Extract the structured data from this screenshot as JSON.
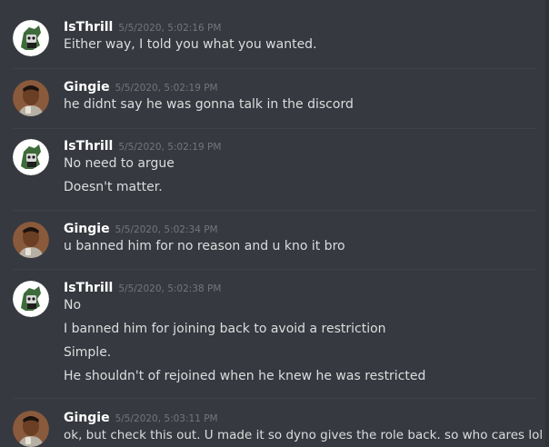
{
  "colors": {
    "background": "#36393f",
    "username": "#ffffff",
    "timestamp": "#72767d",
    "message_text": "#dcddde",
    "isthrill_avatar_bg": "#ffffff",
    "isthrill_avatar_accent": "#3e6b3a",
    "gingie_avatar_bg": "#7a4a30"
  },
  "messages": [
    {
      "username": "IsThrill",
      "avatar": "isthrill-avatar",
      "timestamp": "5/5/2020, 5:02:16 PM",
      "lines": [
        "Either way, I told you what you wanted."
      ]
    },
    {
      "username": "Gingie",
      "avatar": "gingie-avatar",
      "timestamp": "5/5/2020, 5:02:19 PM",
      "lines": [
        "he didnt say he was gonna talk in the discord"
      ]
    },
    {
      "username": "IsThrill",
      "avatar": "isthrill-avatar",
      "timestamp": "5/5/2020, 5:02:19 PM",
      "lines": [
        "No need to argue",
        "Doesn't matter."
      ]
    },
    {
      "username": "Gingie",
      "avatar": "gingie-avatar",
      "timestamp": "5/5/2020, 5:02:34 PM",
      "lines": [
        "u banned him for no reason and u kno it bro"
      ]
    },
    {
      "username": "IsThrill",
      "avatar": "isthrill-avatar",
      "timestamp": "5/5/2020, 5:02:38 PM",
      "lines": [
        "No",
        "I banned him for joining back to avoid a restriction",
        "Simple.",
        "He shouldn't of rejoined when he knew he was restricted"
      ]
    },
    {
      "username": "Gingie",
      "avatar": "gingie-avatar",
      "timestamp": "5/5/2020, 5:03:11 PM",
      "lines": [
        "ok, but check this out. U made it so dyno gives the role back. so who cares lol"
      ]
    }
  ]
}
